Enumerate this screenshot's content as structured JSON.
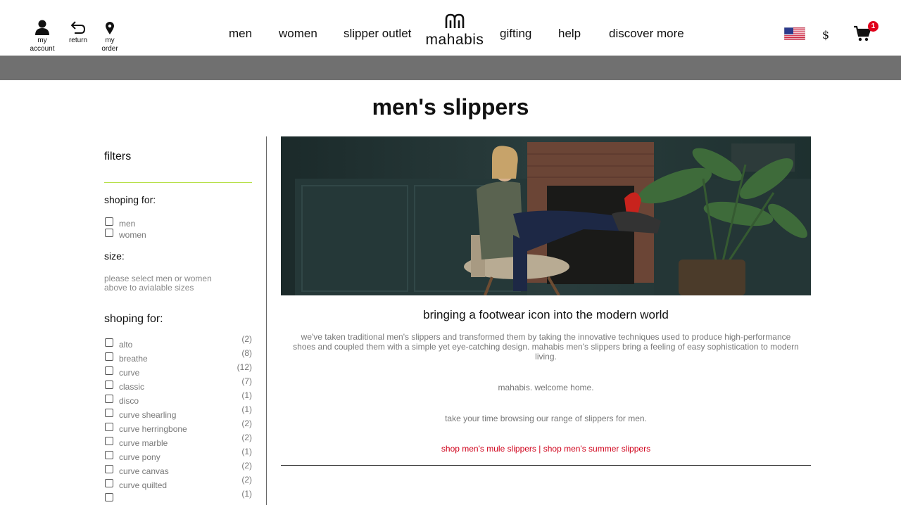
{
  "header": {
    "account": {
      "label_line1": "my",
      "label_line2": "account"
    },
    "return": {
      "label": "return"
    },
    "order": {
      "label_line1": "my",
      "label_line2": "order"
    },
    "nav": [
      "men",
      "women",
      "slipper outlet",
      "gifting",
      "help",
      "discover more"
    ],
    "logo_text": "mahabis",
    "currency": "$",
    "cart_count": "1"
  },
  "page": {
    "title": "men's slippers"
  },
  "sidebar": {
    "filters_title": "filters",
    "shopping_for_heading": "shoping for:",
    "gender_options": [
      "men",
      "women"
    ],
    "size_heading": "size:",
    "size_note_line1": "please select men or women",
    "size_note_line2": "above to avialable sizes",
    "styles_heading": "shoping for:",
    "styles": [
      {
        "label": "alto",
        "count": "(2)"
      },
      {
        "label": "breathe",
        "count": "(8)"
      },
      {
        "label": "curve",
        "count": "(12)"
      },
      {
        "label": "classic",
        "count": "(7)"
      },
      {
        "label": "disco",
        "count": "(1)"
      },
      {
        "label": "curve shearling",
        "count": "(1)"
      },
      {
        "label": "curve herringbone",
        "count": "(2)"
      },
      {
        "label": "curve marble",
        "count": "(2)"
      },
      {
        "label": "curve pony",
        "count": "(1)"
      },
      {
        "label": "curve canvas",
        "count": "(2)"
      },
      {
        "label": "curve quilted",
        "count": "(2)"
      },
      {
        "label": "",
        "count": "(1)"
      }
    ]
  },
  "main": {
    "heading": "bringing a footwear icon into the modern world",
    "para1_line1": "we've taken traditional men's slippers and transformed them by taking the innovative techniques used to produce high-performance",
    "para1_line2": "shoes and coupled them with a simple yet eye-catching design. mahabis men's slippers bring a feeling of easy sophistication to modern",
    "para1_line3": "living.",
    "para2": "mahabis. welcome home.",
    "para3": "take your time browsing our range of slippers for men.",
    "link1": "shop men's mule slippers",
    "link_sep": " | ",
    "link2": "shop men's summer slippers"
  },
  "colors": {
    "accent_link": "#d0021b",
    "filter_rule": "#b7e04a",
    "band": "#707070",
    "badge": "#e0001b"
  }
}
